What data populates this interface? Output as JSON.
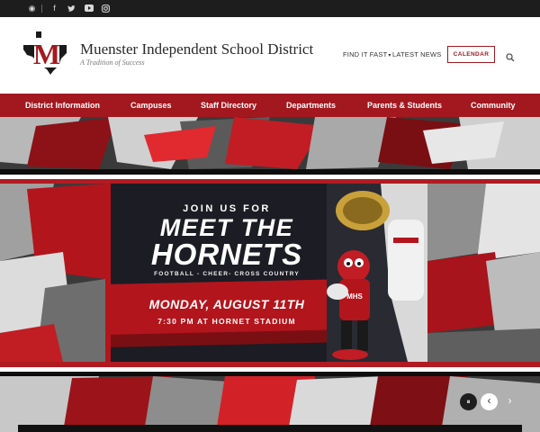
{
  "topbar": {
    "icons": [
      "school-app-icon",
      "facebook-icon",
      "twitter-icon",
      "youtube-icon",
      "instagram-icon"
    ],
    "glyphs": {
      "app": "◉",
      "facebook": "f",
      "twitter": "🐦",
      "youtube": "▶",
      "instagram": "◎"
    }
  },
  "header": {
    "logo_letter": "M",
    "title": "Muenster Independent School District",
    "tagline": "A Tradition of Success",
    "find_it_fast": "FIND IT FAST",
    "latest_news": "LATEST NEWS",
    "calendar": "CALENDAR"
  },
  "nav": {
    "items": [
      "District Information",
      "Campuses",
      "Staff Directory",
      "Departments",
      "Parents & Students",
      "Community"
    ]
  },
  "hero": {
    "join": "JOIN US FOR",
    "meet": "MEET THE",
    "hornets": "HORNETS",
    "sports": "FOOTBALL - CHEER- CROSS COUNTRY",
    "date": "MONDAY, AUGUST 11TH",
    "time": "7:30 PM AT HORNET STADIUM",
    "mascot_letters": "MHS",
    "controls": {
      "pause": "⏸",
      "prev": "‹",
      "next": "›"
    }
  },
  "colors": {
    "brand_red": "#a3181f",
    "topbar": "#1d1d1d",
    "panel": "#1c1c24"
  }
}
